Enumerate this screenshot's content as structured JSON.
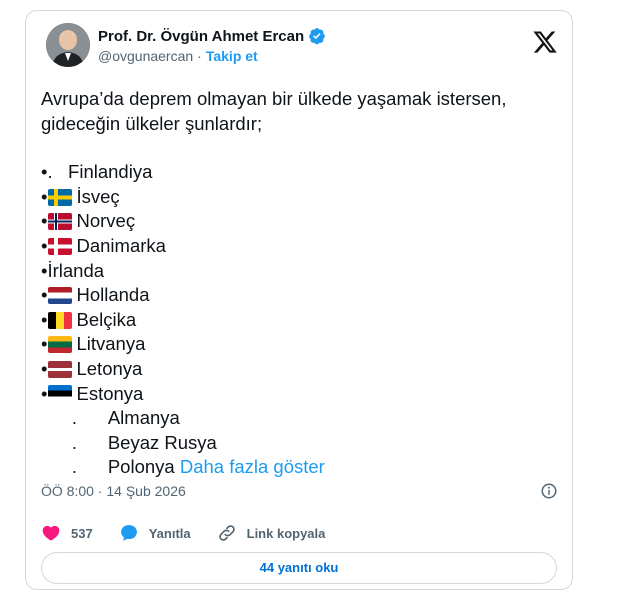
{
  "author": {
    "name": "Prof. Dr. Övgün Ahmet Ercan",
    "handle": "@ovgunaercan",
    "separator": "·",
    "follow_label": "Takip et"
  },
  "tweet": {
    "intro": "Avrupa’da deprem olmayan bir ülkede yaşamak istersen, gideceğin ülkeler şunlardır;",
    "items": [
      {
        "prefix": "•.   ",
        "flag": "",
        "text": "Finlandiya"
      },
      {
        "prefix": "•",
        "flag": "sweden",
        "text": "İsveç"
      },
      {
        "prefix": "•",
        "flag": "norway",
        "text": "Norveç"
      },
      {
        "prefix": "•",
        "flag": "denmark",
        "text": "Danimarka"
      },
      {
        "prefix": "•",
        "flag": "",
        "text": "İrlanda"
      },
      {
        "prefix": "•",
        "flag": "netherlands",
        "text": "Hollanda"
      },
      {
        "prefix": "•",
        "flag": "belgium",
        "text": "Belçika"
      },
      {
        "prefix": "•",
        "flag": "lithuania",
        "text": "Litvanya"
      },
      {
        "prefix": "•",
        "flag": "latvia",
        "text": "Letonya"
      },
      {
        "prefix": "•",
        "flag": "estonia",
        "text": "Estonya"
      },
      {
        "prefix": "      .      ",
        "flag": "",
        "text": "Almanya"
      },
      {
        "prefix": "      .      ",
        "flag": "",
        "text": "Beyaz Rusya"
      },
      {
        "prefix": "      .      ",
        "flag": "",
        "text": "Polonya "
      }
    ],
    "show_more": "Daha fazla göster",
    "timestamp": "ÖÖ 8:00 · 14 Şub 2026"
  },
  "actions": {
    "likes": "537",
    "reply_label": "Yanıtla",
    "copy_link_label": "Link kopyala"
  },
  "replies_button": "44 yanıtı oku",
  "colors": {
    "accent": "#1d9bf0",
    "like": "#f91880",
    "text": "#0f1419",
    "muted": "#536471",
    "border": "#cfd9de"
  }
}
